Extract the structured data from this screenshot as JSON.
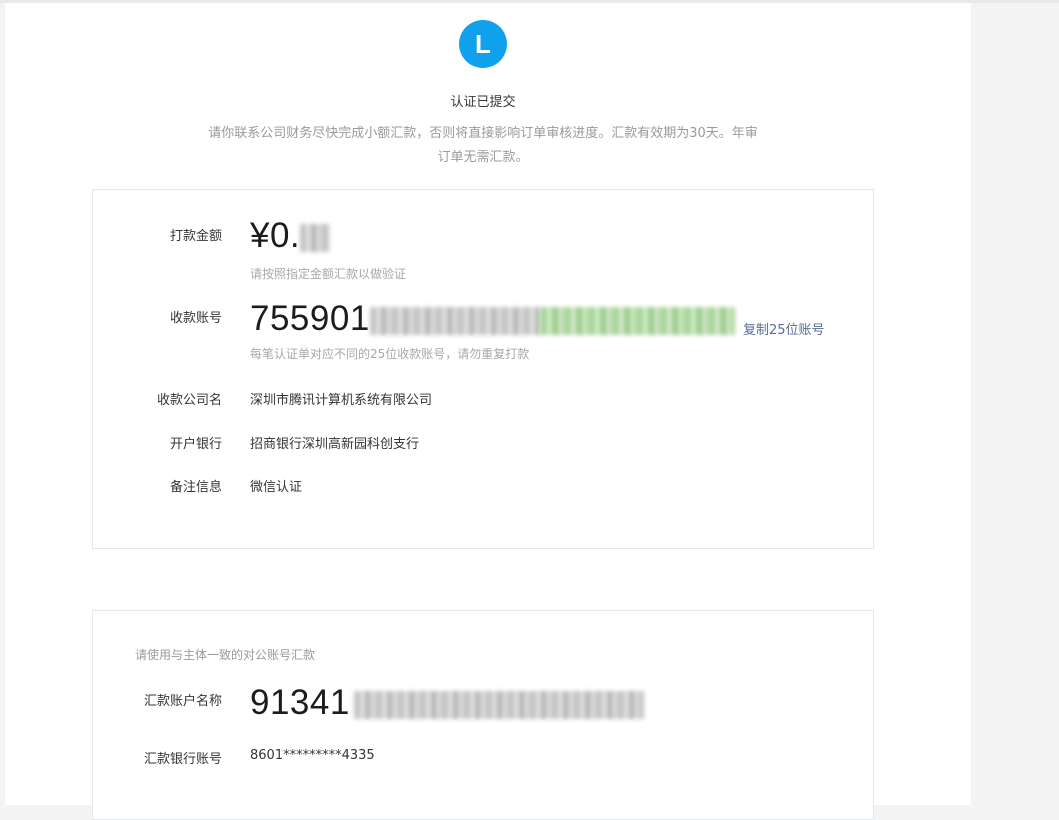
{
  "header": {
    "logo_letter": "L",
    "title": "认证已提交",
    "notice": "请你联系公司财务尽快完成小额汇款，否则将直接影响订单审核进度。汇款有效期为30天。年审订单无需汇款。"
  },
  "payment_card": {
    "amount": {
      "label": "打款金额",
      "value_prefix": "¥0.",
      "hint": "请按照指定金额汇款以做验证"
    },
    "account": {
      "label": "收款账号",
      "value_prefix": "755901",
      "copy_label": "复制25位账号",
      "hint": "每笔认证单对应不同的25位收款账号，请勿重复打款"
    },
    "company": {
      "label": "收款公司名",
      "value": "深圳市腾讯计算机系统有限公司"
    },
    "bank": {
      "label": "开户银行",
      "value": "招商银行深圳高新园科创支行"
    },
    "remark": {
      "label": "备注信息",
      "value": "微信认证"
    }
  },
  "remitter_card": {
    "title": "请使用与主体一致的对公账号汇款",
    "account_name": {
      "label": "汇款账户名称",
      "value_prefix": "91341"
    },
    "bank_account": {
      "label": "汇款银行账号",
      "value": "8601*********4335"
    }
  },
  "colors": {
    "accent": "#10a0ec",
    "link": "#576b95",
    "hint": "#a8a8a8"
  }
}
